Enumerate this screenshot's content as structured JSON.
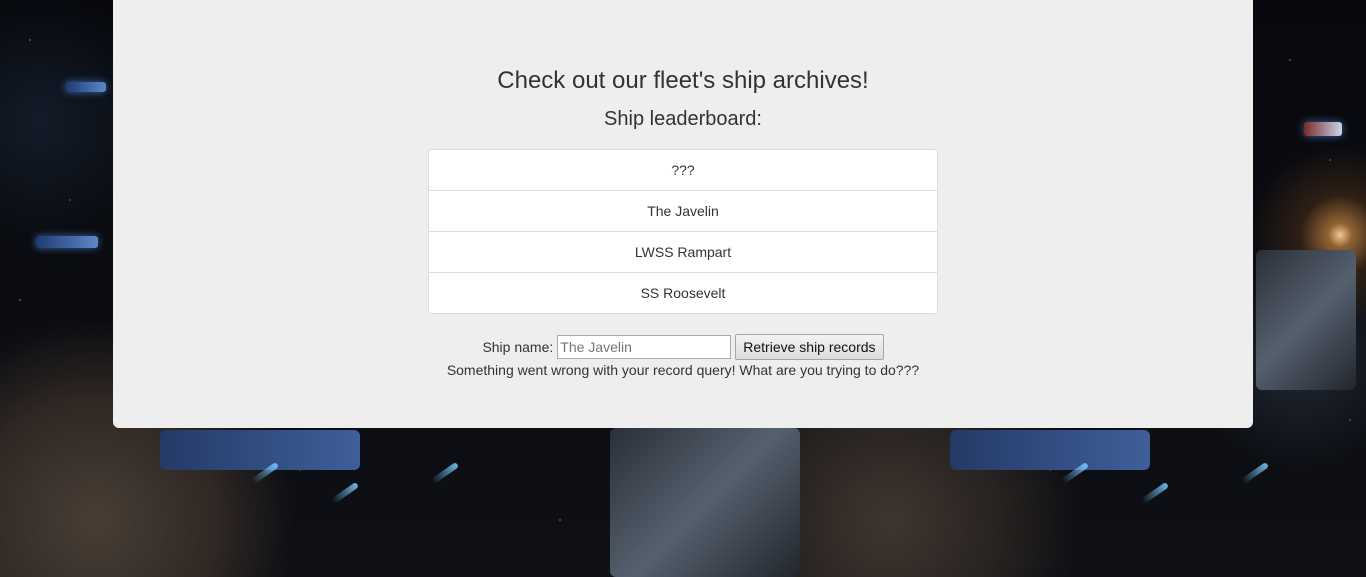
{
  "page": {
    "title": "Check out our fleet's ship archives!",
    "subtitle": "Ship leaderboard:"
  },
  "leaderboard": [
    "???",
    "The Javelin",
    "LWSS Rampart",
    "SS Roosevelt"
  ],
  "query": {
    "label": "Ship name:",
    "placeholder": "The Javelin",
    "value": "",
    "button_label": "Retrieve ship records"
  },
  "error_message": "Something went wrong with your record query! What are you trying to do???",
  "colors": {
    "panel_background": "#eeeeee",
    "text": "#333333",
    "list_border": "#dddddd"
  }
}
